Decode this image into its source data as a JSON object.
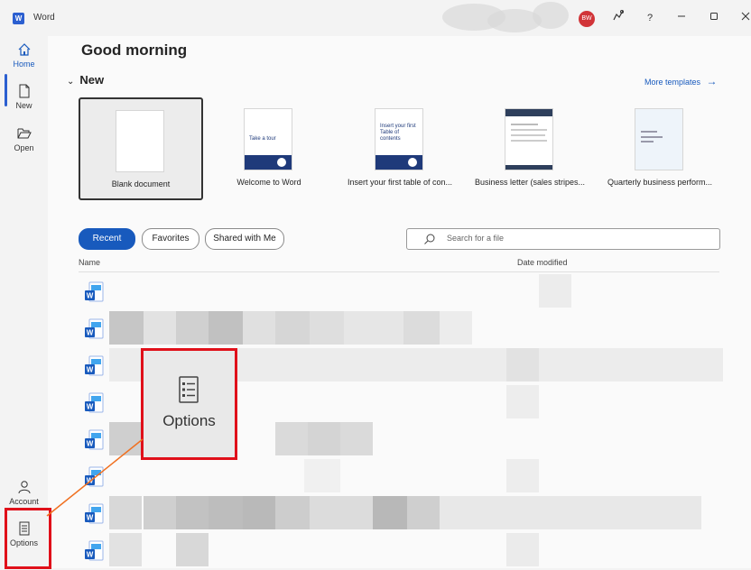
{
  "titlebar": {
    "app_logo": "W",
    "app_title": "Word",
    "avatar_initials": "BW",
    "help_label": "?",
    "icons": [
      "coauthor-icon",
      "help-icon",
      "minimize-icon",
      "maximize-icon",
      "close-icon"
    ]
  },
  "nav": {
    "home": "Home",
    "new": "New",
    "open": "Open",
    "account": "Account",
    "options": "Options"
  },
  "main": {
    "greeting": "Good morning",
    "new_header": "New",
    "more_templates": "More templates"
  },
  "templates": [
    {
      "label": "Blank document"
    },
    {
      "label": "Welcome to Word",
      "thumb_text": "Take a tour"
    },
    {
      "label": "Insert your first table of con...",
      "thumb_text": "Insert your first Table of contents"
    },
    {
      "label": "Business letter (sales stripes..."
    },
    {
      "label": "Quarterly business perform..."
    }
  ],
  "tabs": {
    "recent": "Recent",
    "favorites": "Favorites",
    "shared": "Shared with Me"
  },
  "search": {
    "placeholder": "Search for a file"
  },
  "columns": {
    "name": "Name",
    "date": "Date modified"
  },
  "callout": {
    "label": "Options"
  },
  "colors": {
    "accent": "#185abd",
    "highlight": "#e0101a",
    "pointer": "#f07020"
  }
}
